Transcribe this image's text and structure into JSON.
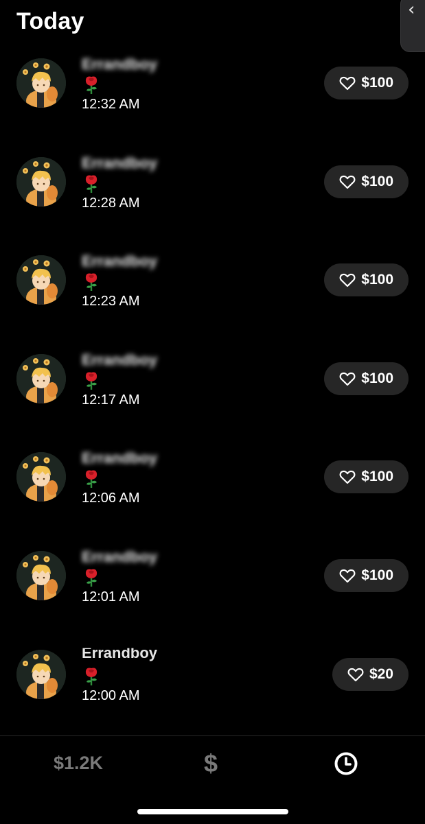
{
  "header": {
    "title": "Today",
    "side_tab_icon": "chevron-left-icon"
  },
  "tips": [
    {
      "name": "Errandboy",
      "gift_icon": "rose-icon",
      "time": "12:32 AM",
      "amount": "$100",
      "name_blurred": true
    },
    {
      "name": "Errandboy",
      "gift_icon": "rose-icon",
      "time": "12:28 AM",
      "amount": "$100",
      "name_blurred": true
    },
    {
      "name": "Errandboy",
      "gift_icon": "rose-icon",
      "time": "12:23 AM",
      "amount": "$100",
      "name_blurred": true
    },
    {
      "name": "Errandboy",
      "gift_icon": "rose-icon",
      "time": "12:17 AM",
      "amount": "$100",
      "name_blurred": true
    },
    {
      "name": "Errandboy",
      "gift_icon": "rose-icon",
      "time": "12:06 AM",
      "amount": "$100",
      "name_blurred": true
    },
    {
      "name": "Errandboy",
      "gift_icon": "rose-icon",
      "time": "12:01 AM",
      "amount": "$100",
      "name_blurred": true
    },
    {
      "name": "Errandboy",
      "gift_icon": "rose-icon",
      "time": "12:00 AM",
      "amount": "$20",
      "name_blurred": false
    }
  ],
  "bottom_nav": {
    "balance_label": "$1.2K",
    "dollar_label": "$",
    "history_icon": "clock-icon",
    "active_tab": "history"
  },
  "colors": {
    "background": "#000000",
    "button_bg": "#262626",
    "inactive_nav": "#7a7a7a",
    "active_nav": "#ffffff"
  }
}
